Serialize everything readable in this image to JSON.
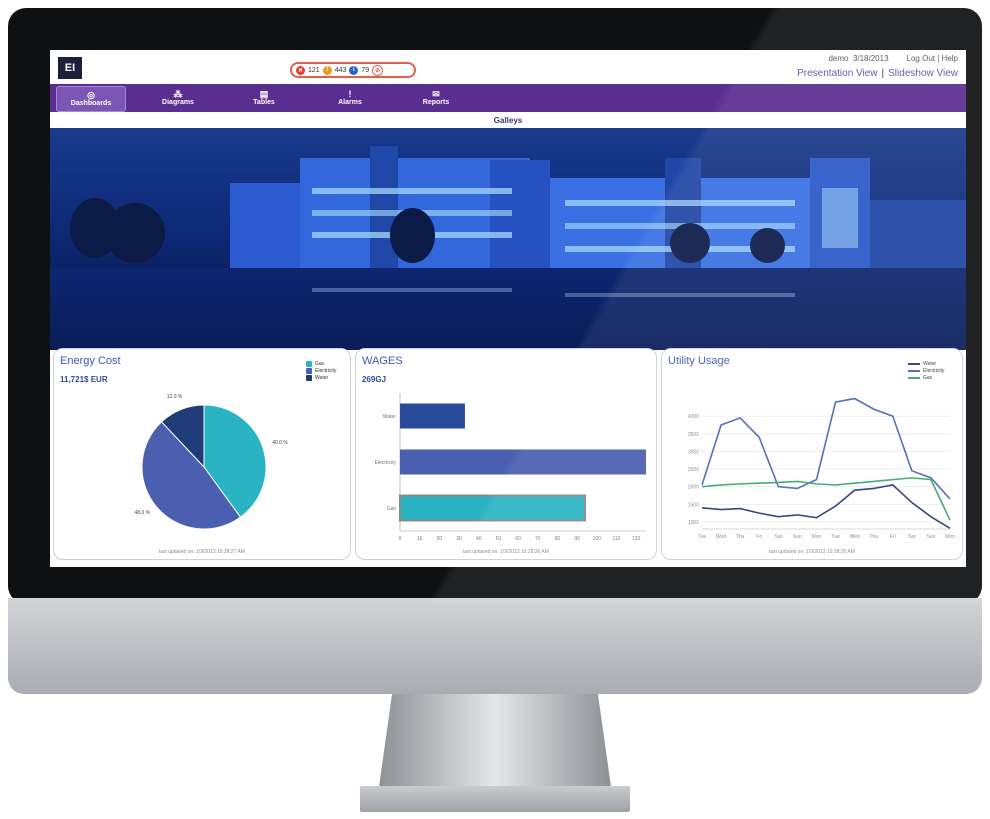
{
  "header": {
    "logo_text": "EI",
    "alerts": [
      {
        "count": "121",
        "icon": "error-icon",
        "color": "#e0412a"
      },
      {
        "count": "443",
        "icon": "warning-icon",
        "color": "#e89a1a"
      },
      {
        "count": "79",
        "icon": "info-icon",
        "color": "#2a66c8"
      },
      {
        "count": "",
        "icon": "mute-icon",
        "color": "#e0604a"
      }
    ],
    "user": "demo",
    "date": "3/18/2013",
    "logout": "Log Out",
    "help_sep": "|",
    "help": "Help",
    "presentation_view": "Presentation View",
    "view_sep": "|",
    "slideshow_view": "Slideshow View"
  },
  "nav": {
    "items": [
      {
        "label": "Dashboards",
        "icon": "dashboard-icon",
        "active": true
      },
      {
        "label": "Diagrams",
        "icon": "diagram-icon",
        "active": false
      },
      {
        "label": "Tables",
        "icon": "table-icon",
        "active": false
      },
      {
        "label": "Alarms",
        "icon": "alarm-icon",
        "active": false
      },
      {
        "label": "Reports",
        "icon": "report-icon",
        "active": false
      }
    ]
  },
  "page_title": "Galleys",
  "colors": {
    "nav": "#5a2d90",
    "gas": "#2ab3c2",
    "electricity": "#4a5fb0",
    "water": "#1f3c78"
  },
  "cards": {
    "energy": {
      "title": "Energy Cost",
      "subtitle": "11,721$ EUR",
      "footer": "last updated on: 1/9/2013 10:28:27 AM"
    },
    "wages": {
      "title": "WAGES",
      "subtitle": "269GJ",
      "footer": "last updated on: 1/9/2013 10:28:26 AM"
    },
    "utility": {
      "title": "Utility Usage",
      "footer": "last updated on: 1/9/2013 10:28:26 AM"
    }
  },
  "chart_data": [
    {
      "type": "pie",
      "title": "Energy Cost",
      "categories": [
        "Gas",
        "Electricity",
        "Water"
      ],
      "values": [
        40.0,
        48.0,
        12.0
      ],
      "labels": [
        "40.0 %",
        "48.0 %",
        "12.0 %"
      ],
      "colors": [
        "#2ab3c2",
        "#4a5fb0",
        "#1f3c78"
      ],
      "legend": "top-right"
    },
    {
      "type": "bar",
      "orientation": "horizontal",
      "title": "WAGES",
      "categories": [
        "Water",
        "Electricity",
        "Gas"
      ],
      "values": [
        33,
        125,
        94
      ],
      "colors": [
        "#2a4a9c",
        "#4a5fb0",
        "#2ab3c2"
      ],
      "xlim": [
        0,
        125
      ],
      "xticks": [
        "0",
        "10",
        "20",
        "30",
        "40",
        "50",
        "60",
        "70",
        "80",
        "90",
        "100",
        "110",
        "120"
      ]
    },
    {
      "type": "line",
      "title": "Utility Usage",
      "categories": [
        "Tue",
        "Wed",
        "Thu",
        "Fri",
        "Sat",
        "Sun",
        "Mon",
        "Tue",
        "Wed",
        "Thu",
        "Fri",
        "Sat",
        "Sun",
        "Mon"
      ],
      "series": [
        {
          "name": "Water",
          "color": "#2a3a7a",
          "values": [
            1400,
            1350,
            1380,
            1250,
            1150,
            1200,
            1120,
            1450,
            1900,
            1950,
            2050,
            1550,
            1150,
            820
          ]
        },
        {
          "name": "Electricity",
          "color": "#4a64b8",
          "values": [
            2050,
            3750,
            3950,
            3400,
            2000,
            1950,
            2200,
            4400,
            4500,
            4200,
            4000,
            2450,
            2250,
            1650
          ]
        },
        {
          "name": "Gas",
          "color": "#3aa66e",
          "values": [
            2000,
            2050,
            2080,
            2100,
            2120,
            2150,
            2080,
            2050,
            2100,
            2150,
            2200,
            2250,
            2200,
            1050
          ]
        }
      ],
      "ylim": [
        800,
        4600
      ],
      "yticks": [
        "1000",
        "1500",
        "2000",
        "2500",
        "3000",
        "3500",
        "4000"
      ],
      "legend": "top-right",
      "grid": true
    }
  ]
}
